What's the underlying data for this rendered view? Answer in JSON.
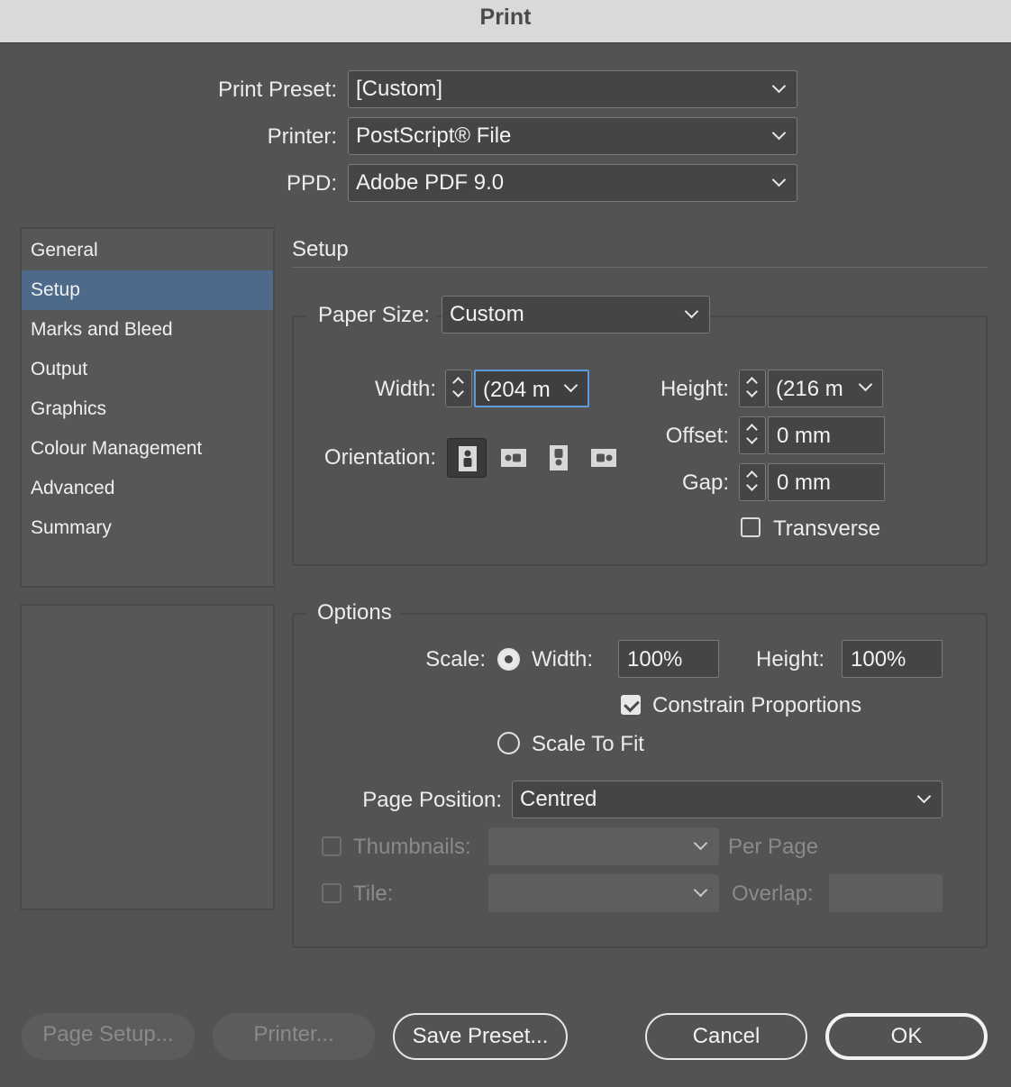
{
  "window": {
    "title": "Print"
  },
  "top": {
    "preset_label": "Print Preset:",
    "preset_value": "[Custom]",
    "printer_label": "Printer:",
    "printer_value": "PostScript® File",
    "ppd_label": "PPD:",
    "ppd_value": "Adobe PDF 9.0"
  },
  "sidebar": {
    "items": [
      {
        "label": "General"
      },
      {
        "label": "Setup",
        "selected": true
      },
      {
        "label": "Marks and Bleed"
      },
      {
        "label": "Output"
      },
      {
        "label": "Graphics"
      },
      {
        "label": "Colour Management"
      },
      {
        "label": "Advanced"
      },
      {
        "label": "Summary"
      }
    ]
  },
  "setup": {
    "heading": "Setup",
    "paper_size_label": "Paper Size:",
    "paper_size_value": "Custom",
    "width_label": "Width:",
    "width_value": "(204 m",
    "height_label": "Height:",
    "height_value": "(216 m",
    "offset_label": "Offset:",
    "offset_value": "0 mm",
    "gap_label": "Gap:",
    "gap_value": "0 mm",
    "orientation_label": "Orientation:",
    "transverse_label": "Transverse",
    "transverse_checked": false
  },
  "options": {
    "heading": "Options",
    "scale_label": "Scale:",
    "scale_width_label": "Width:",
    "scale_width_value": "100%",
    "scale_height_label": "Height:",
    "scale_height_value": "100%",
    "constrain_label": "Constrain Proportions",
    "constrain_checked": true,
    "scale_to_fit_label": "Scale To Fit",
    "page_position_label": "Page Position:",
    "page_position_value": "Centred",
    "thumbnails_label": "Thumbnails:",
    "per_page_label": "Per Page",
    "tile_label": "Tile:",
    "overlap_label": "Overlap:"
  },
  "buttons": {
    "page_setup": "Page Setup...",
    "printer": "Printer...",
    "save_preset": "Save Preset...",
    "cancel": "Cancel",
    "ok": "OK"
  },
  "colors": {
    "selection": "#4e6a8a",
    "focus": "#5b9be0",
    "background": "#535353"
  }
}
